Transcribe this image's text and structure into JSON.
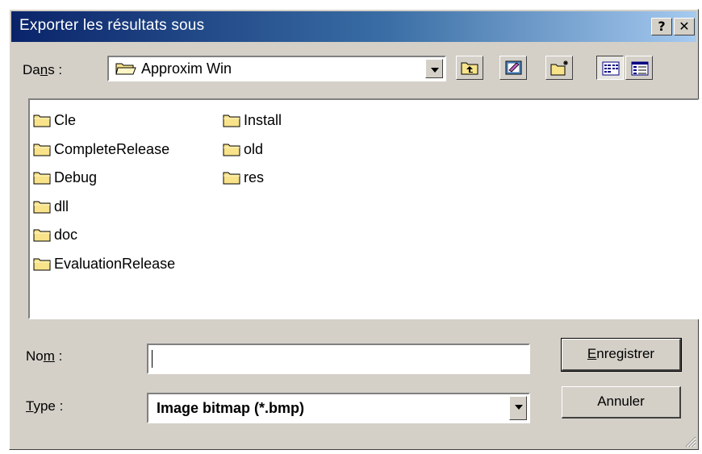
{
  "window": {
    "title": "Exporter les résultats sous",
    "help_label": "?",
    "close_label": "✕"
  },
  "location": {
    "label_pre": "Da",
    "label_accel": "n",
    "label_post": "s :",
    "value": "Approxim Win"
  },
  "toolbar": {
    "buttons": [
      "up-one-level",
      "desktop",
      "create-new-folder",
      "list-view",
      "details-view"
    ]
  },
  "files": {
    "column1": [
      "Cle",
      "CompleteRelease",
      "Debug",
      "dll",
      "doc",
      "EvaluationRelease"
    ],
    "column2": [
      "Install",
      "old",
      "res"
    ]
  },
  "filename": {
    "label_pre": "No",
    "label_accel": "m",
    "label_post": " :",
    "value": ""
  },
  "filetype": {
    "label_accel": "T",
    "label_post": "ype :",
    "value": "Image bitmap (*.bmp)"
  },
  "buttons": {
    "save_accel": "E",
    "save_rest": "nregistrer",
    "cancel": "Annuler"
  },
  "colors": {
    "title_start": "#0a246a",
    "title_end": "#a6caf0",
    "face": "#d4d0c8",
    "folder": "#f8e38a"
  }
}
